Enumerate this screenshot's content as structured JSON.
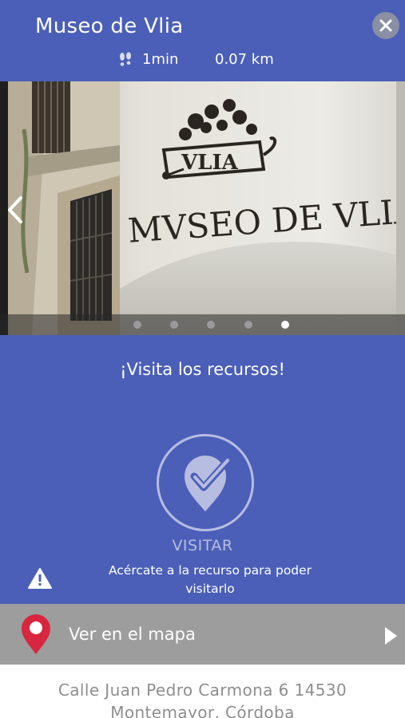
{
  "header": {
    "title": "Museo de Vlia",
    "walk_time": "1min",
    "distance": "0.07 km",
    "close_icon": "close-icon",
    "walk_icon": "footsteps-icon"
  },
  "carousel": {
    "photo_sign_text": "MVSEO DE VLIA",
    "photo_logo_text": "VLIA",
    "slide_count": 5,
    "active_slide": 5
  },
  "main": {
    "heading": "¡Visita los recursos!",
    "visit_label": "VISITAR",
    "hint": "Acércate a la recurso para poder visitarlo"
  },
  "map_bar": {
    "label": "Ver en el mapa",
    "icon": "map-pin-icon",
    "arrow_icon": "chevron-right-icon"
  },
  "address": {
    "line1": "Calle Juan Pedro Carmona 6 14530",
    "line2": "Montemayor, Córdoba"
  },
  "colors": {
    "primary": "#4b5fb8",
    "map_bar": "#9d9d9d",
    "pin_red": "#d7263d",
    "muted_accent": "#b7bde0"
  }
}
